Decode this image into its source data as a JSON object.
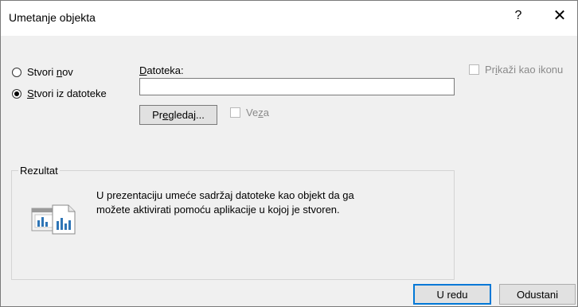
{
  "dialog": {
    "title": "Umetanje objekta",
    "help_glyph": "?",
    "close_glyph": "✕"
  },
  "options": {
    "create_new": {
      "pre": "Stvori ",
      "key": "n",
      "post": "ov",
      "checked": false
    },
    "create_from_file": {
      "pre": "",
      "key": "S",
      "post": "tvori iz datoteke",
      "checked": true
    }
  },
  "file": {
    "label_key": "D",
    "label_rest": "atoteka:",
    "value": "",
    "browse": {
      "pre": "Pr",
      "key": "e",
      "post": "gledaj..."
    },
    "link": {
      "pre": "Ve",
      "key": "z",
      "post": "a",
      "checked": false,
      "disabled": true
    }
  },
  "display_as_icon": {
    "pre": "Pr",
    "key": "i",
    "post": "kaži kao ikonu",
    "checked": false,
    "disabled": true
  },
  "result": {
    "label": "Rezultat",
    "line1": "U prezentaciju umeće sadržaj datoteke kao objekt da ga",
    "line2": "možete aktivirati pomoću aplikacije u kojoj je stvoren.",
    "icon": "linked-file-chart-icon"
  },
  "buttons": {
    "ok": "U redu",
    "cancel": "Odustani"
  },
  "colors": {
    "default_button_border": "#0078d7",
    "dialog_background": "#f0f0f0",
    "icon_blue": "#2e75b6"
  }
}
